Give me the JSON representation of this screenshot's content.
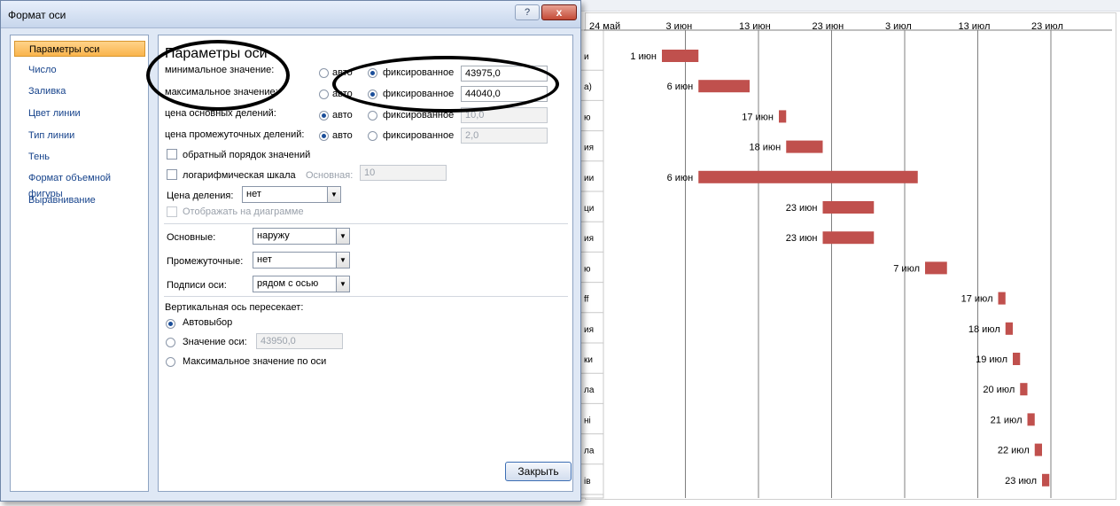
{
  "dialog": {
    "title": "Формат оси",
    "help_glyph": "?",
    "close_glyph": "x",
    "close_button": "Закрыть"
  },
  "nav": {
    "items": [
      {
        "label": "Параметры оси",
        "selected": true
      },
      {
        "label": "Число"
      },
      {
        "label": "Заливка"
      },
      {
        "label": "Цвет линии"
      },
      {
        "label": "Тип линии"
      },
      {
        "label": "Тень"
      },
      {
        "label": "Формат объемной фигуры"
      },
      {
        "label": "Выравнивание"
      }
    ]
  },
  "axis_params": {
    "heading": "Параметры оси",
    "min": {
      "label": "минимальное значение:",
      "auto": "авто",
      "fixed": "фиксированное",
      "value": "43975,0",
      "selected": "fixed"
    },
    "max": {
      "label": "максимальное значение:",
      "auto": "авто",
      "fixed": "фиксированное",
      "value": "44040,0",
      "selected": "fixed"
    },
    "major": {
      "label": "цена основных делений:",
      "auto": "авто",
      "fixed": "фиксированное",
      "value": "10,0",
      "selected": "auto"
    },
    "minor": {
      "label": "цена промежуточных делений:",
      "auto": "авто",
      "fixed": "фиксированное",
      "value": "2,0",
      "selected": "auto"
    },
    "reverse_order": "обратный порядок значений",
    "log_scale": "логарифмическая шкала",
    "log_base_label": "Основная:",
    "log_base_value": "10",
    "display_units_label": "Цена деления:",
    "display_units_value": "нет",
    "show_on_chart": "Отображать на диаграмме",
    "major_tick_label": "Основные:",
    "major_tick_value": "наружу",
    "minor_tick_label": "Промежуточные:",
    "minor_tick_value": "нет",
    "axis_labels_label": "Подписи оси:",
    "axis_labels_value": "рядом с осью",
    "crosses_heading": "Вертикальная ось пересекает:",
    "crosses_auto": "Автовыбор",
    "crosses_value_label": "Значение оси:",
    "crosses_value": "43950,0",
    "crosses_max": "Максимальное значение по оси"
  },
  "chart_data": {
    "type": "bar",
    "x_ticks": [
      "24 май",
      "3 июн",
      "13 июн",
      "23 июн",
      "3 июл",
      "13 июл",
      "23 июл"
    ],
    "bars": [
      {
        "label": "1 июн",
        "start": 1,
        "duration": 5,
        "row_stub": "и"
      },
      {
        "label": "6 июн",
        "start": 6,
        "duration": 7,
        "row_stub": "а)"
      },
      {
        "label": "17 июн",
        "start": 17,
        "duration": 1,
        "row_stub": "ю"
      },
      {
        "label": "18 июн",
        "start": 18,
        "duration": 5,
        "row_stub": "ия"
      },
      {
        "label": "6 июн",
        "start": 6,
        "duration": 30,
        "row_stub": "ии"
      },
      {
        "label": "23 июн",
        "start": 23,
        "duration": 7,
        "row_stub": "ци"
      },
      {
        "label": "23 июн",
        "start": 23,
        "duration": 7,
        "row_stub": "ия"
      },
      {
        "label": "7 июл",
        "start": 37,
        "duration": 3,
        "row_stub": "ю"
      },
      {
        "label": "17 июл",
        "start": 47,
        "duration": 1,
        "row_stub": "ff"
      },
      {
        "label": "18 июл",
        "start": 48,
        "duration": 1,
        "row_stub": "ия"
      },
      {
        "label": "19 июл",
        "start": 49,
        "duration": 1,
        "row_stub": "ки"
      },
      {
        "label": "20 июл",
        "start": 50,
        "duration": 1,
        "row_stub": "ла"
      },
      {
        "label": "21 июл",
        "start": 51,
        "duration": 1,
        "row_stub": "ні"
      },
      {
        "label": "22 июл",
        "start": 52,
        "duration": 1,
        "row_stub": "ла"
      },
      {
        "label": "23 июл",
        "start": 53,
        "duration": 1,
        "row_stub": "ів"
      }
    ],
    "bar_color": "#c0504d",
    "grid": true
  }
}
